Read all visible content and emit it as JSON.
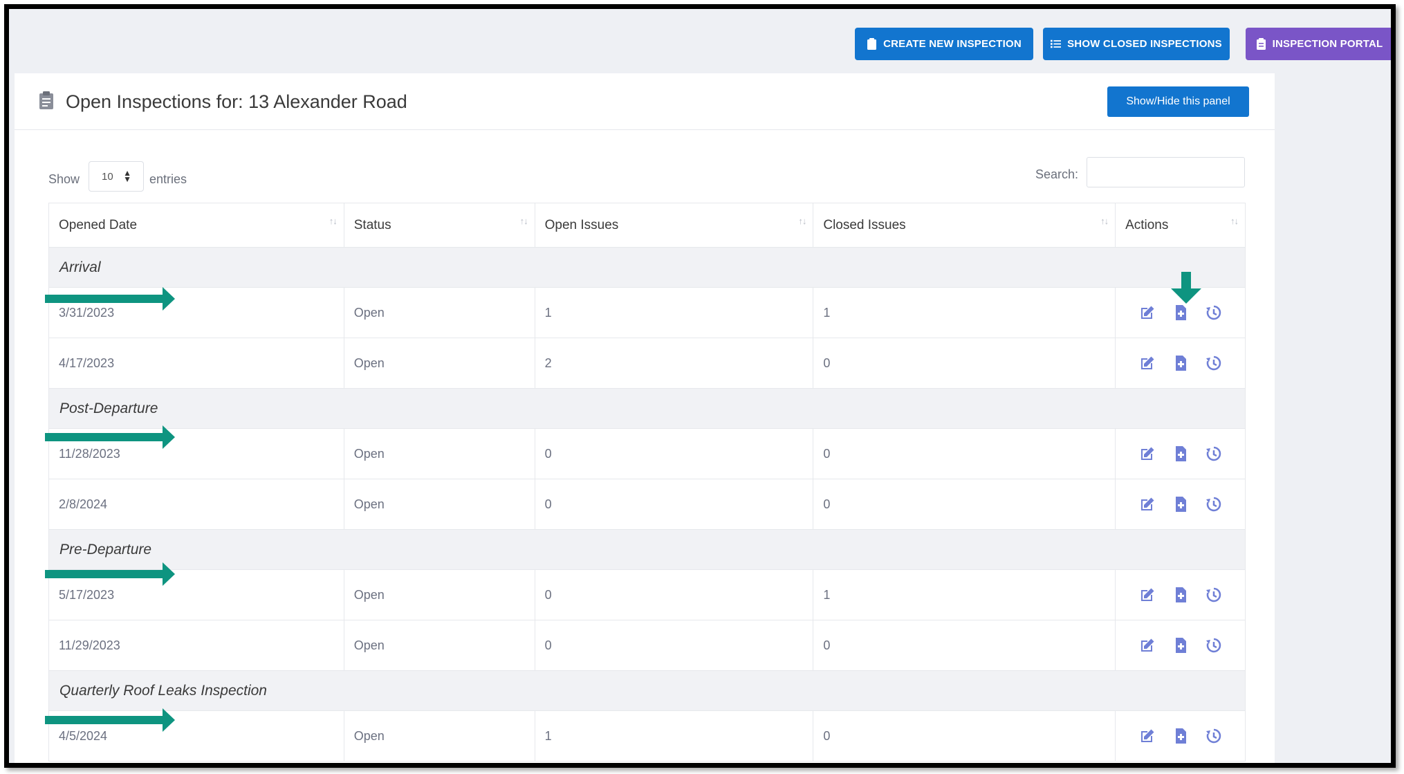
{
  "toolbar": {
    "create_label": "CREATE NEW INSPECTION",
    "closed_label": "SHOW CLOSED INSPECTIONS",
    "portal_label": "INSPECTION PORTAL"
  },
  "panel": {
    "title": "Open Inspections for: 13 Alexander Road",
    "toggle_label": "Show/Hide this panel"
  },
  "controls": {
    "show_label": "Show",
    "entries_value": "10",
    "entries_label": "entries",
    "search_label": "Search:"
  },
  "table": {
    "headers": [
      "Opened Date",
      "Status",
      "Open Issues",
      "Closed Issues",
      "Actions"
    ],
    "groups": [
      {
        "name": "Arrival",
        "rows": [
          {
            "date": "3/31/2023",
            "status": "Open",
            "open": "1",
            "closed": "1"
          },
          {
            "date": "4/17/2023",
            "status": "Open",
            "open": "2",
            "closed": "0"
          }
        ]
      },
      {
        "name": "Post-Departure",
        "rows": [
          {
            "date": "11/28/2023",
            "status": "Open",
            "open": "0",
            "closed": "0"
          },
          {
            "date": "2/8/2024",
            "status": "Open",
            "open": "0",
            "closed": "0"
          }
        ]
      },
      {
        "name": "Pre-Departure",
        "rows": [
          {
            "date": "5/17/2023",
            "status": "Open",
            "open": "0",
            "closed": "1"
          },
          {
            "date": "11/29/2023",
            "status": "Open",
            "open": "0",
            "closed": "0"
          }
        ]
      },
      {
        "name": "Quarterly Roof Leaks Inspection",
        "rows": [
          {
            "date": "4/5/2024",
            "status": "Open",
            "open": "1",
            "closed": "0"
          }
        ]
      }
    ]
  },
  "colors": {
    "primary": "#1275cf",
    "portal": "#7a55c7",
    "annotation_arrow": "#0e9480",
    "action_icon": "#6f7fd6"
  },
  "icons": {
    "row_actions": [
      "edit-icon",
      "add-file-icon",
      "history-icon"
    ],
    "header": "clipboard-icon"
  }
}
